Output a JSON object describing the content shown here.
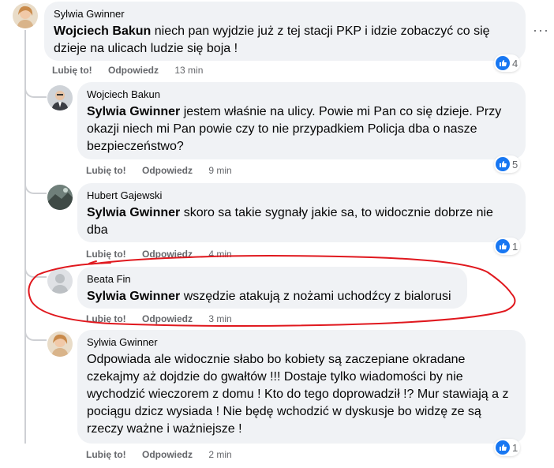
{
  "comments": [
    {
      "author": "Sylwia Gwinner",
      "mention": "Wojciech Bakun",
      "text": " niech pan wyjdzie już z tej stacji PKP i idzie zobaczyć co się dzieje na ulicach ludzie się boja !",
      "like_label": "Lubię to!",
      "reply_label": "Odpowiedz",
      "time": "13 min",
      "reactions": "4"
    },
    {
      "author": "Wojciech Bakun",
      "mention": "Sylwia Gwinner",
      "text": " jestem właśnie na ulicy. Powie mi Pan co się dzieje. Przy okazji niech mi Pan powie czy to nie przypadkiem Policja dba o nasze bezpieczeństwo?",
      "like_label": "Lubię to!",
      "reply_label": "Odpowiedz",
      "time": "9 min",
      "reactions": "5"
    },
    {
      "author": "Hubert Gajewski",
      "mention": "Sylwia Gwinner",
      "text": " skoro sa takie sygnały jakie sa, to widocznie dobrze nie dba",
      "like_label": "Lubię to!",
      "reply_label": "Odpowiedz",
      "time": "4 min",
      "reactions": "1"
    },
    {
      "author": "Beata Fin",
      "mention": "Sylwia Gwinner",
      "text": " wszędzie atakują z nożami uchodźcy z bialorusi",
      "like_label": "Lubię to!",
      "reply_label": "Odpowiedz",
      "time": "3 min"
    },
    {
      "author": "Sylwia Gwinner",
      "text": "Odpowiada ale widocznie słabo bo kobiety są zaczepiane okradane czekajmy aż dojdzie do gwałtów !!! Dostaje tylko wiadomości by nie wychodzić wieczorem z domu ! Kto do tego doprowadził !? Mur stawiają a z pociągu dzicz wysiada ! Nie będę wchodzić w dyskusje bo widzę ze są rzeczy ważne i ważniejsze !",
      "like_label": "Lubię to!",
      "reply_label": "Odpowiedz",
      "time": "2 min",
      "reactions": "1"
    }
  ],
  "more_options": "···",
  "colors": {
    "annotation": "#e0181e",
    "like_blue": "#1877f2",
    "bubble": "#f0f2f5"
  },
  "icons": [
    "avatar",
    "like-icon",
    "more-options-icon"
  ]
}
